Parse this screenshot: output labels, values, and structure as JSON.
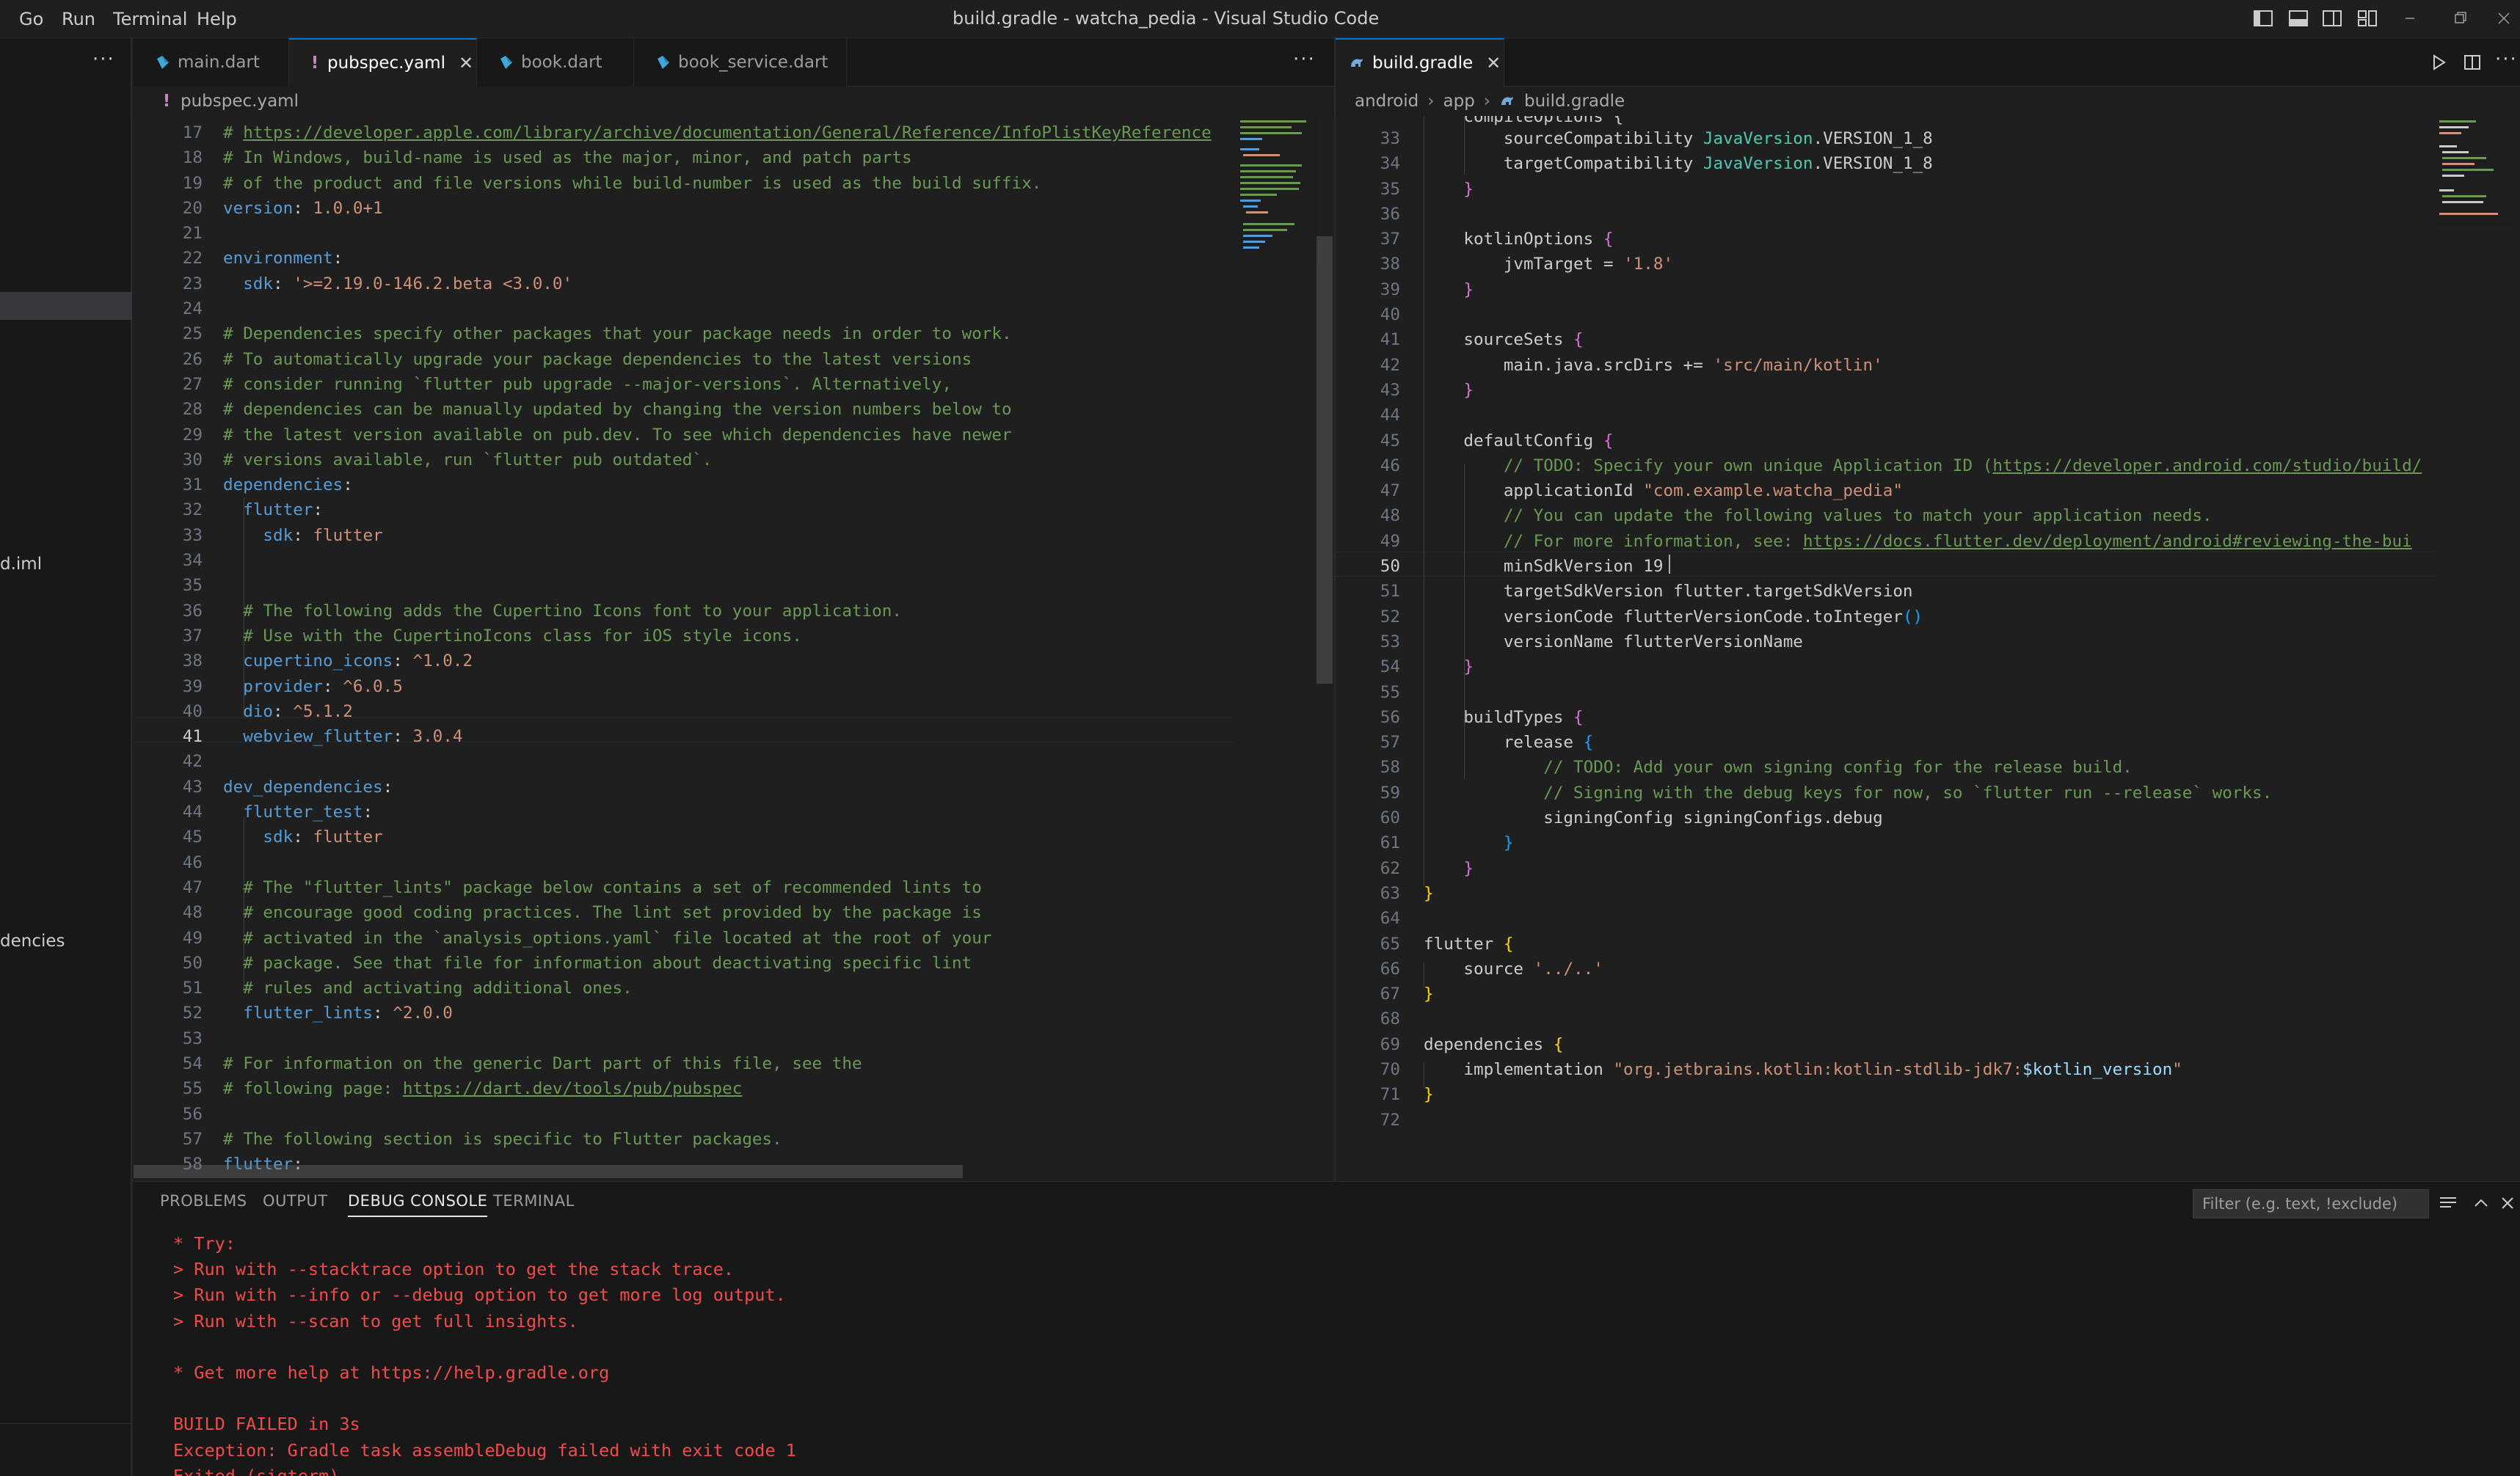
{
  "titlebar": {
    "menu": [
      "Go",
      "Run",
      "Terminal",
      "Help"
    ],
    "title": "build.gradle - watcha_pedia - Visual Studio Code",
    "layout_icons": [
      "toggle-primary-sidebar-icon",
      "toggle-panel-icon",
      "toggle-secondary-sidebar-icon",
      "customize-layout-icon"
    ],
    "window_controls": [
      "minimize-icon",
      "restore-icon",
      "close-icon"
    ]
  },
  "sidebar": {
    "more": "···",
    "fragments": [
      "d.iml",
      "dencies"
    ]
  },
  "left_group": {
    "tabs": [
      {
        "label": "main.dart",
        "type": "dart"
      },
      {
        "label": "pubspec.yaml",
        "type": "yaml",
        "active": true
      },
      {
        "label": "book.dart",
        "type": "dart"
      },
      {
        "label": "book_service.dart",
        "type": "dart"
      }
    ],
    "more": "···",
    "breadcrumb": [
      "pubspec.yaml"
    ],
    "current_line": "41"
  },
  "right_group": {
    "tabs": [
      {
        "label": "build.gradle",
        "type": "gradle",
        "active": true
      }
    ],
    "breadcrumb": [
      "android",
      "app",
      "build.gradle"
    ],
    "current_line": "50"
  },
  "left_code": [
    {
      "n": "17",
      "t": [
        [
          "# ",
          "c-cm"
        ],
        [
          "https://developer.apple.com/library/archive/documentation/General/Reference/InfoPlistKeyReference",
          "c-link"
        ]
      ]
    },
    {
      "n": "18",
      "t": [
        [
          "# In Windows, build-name is used as the major, minor, and patch parts",
          "c-cm"
        ]
      ]
    },
    {
      "n": "19",
      "t": [
        [
          "# of the product and file versions while build-number is used as the build suffix.",
          "c-cm"
        ]
      ]
    },
    {
      "n": "20",
      "t": [
        [
          "version",
          "c-key"
        ],
        [
          ": ",
          "c-plain"
        ],
        [
          "1.0.0+1",
          "c-val"
        ]
      ]
    },
    {
      "n": "21",
      "t": []
    },
    {
      "n": "22",
      "t": [
        [
          "environment",
          "c-key"
        ],
        [
          ":",
          "c-plain"
        ]
      ]
    },
    {
      "n": "23",
      "t": [
        [
          "  sdk",
          "c-key"
        ],
        [
          ": ",
          "c-plain"
        ],
        [
          "'>=2.19.0-146.2.beta <3.0.0'",
          "c-str"
        ]
      ]
    },
    {
      "n": "24",
      "t": []
    },
    {
      "n": "25",
      "t": [
        [
          "# Dependencies specify other packages that your package needs in order to work.",
          "c-cm"
        ]
      ]
    },
    {
      "n": "26",
      "t": [
        [
          "# To automatically upgrade your package dependencies to the latest versions",
          "c-cm"
        ]
      ]
    },
    {
      "n": "27",
      "t": [
        [
          "# consider running `flutter pub upgrade --major-versions`. Alternatively,",
          "c-cm"
        ]
      ]
    },
    {
      "n": "28",
      "t": [
        [
          "# dependencies can be manually updated by changing the version numbers below to",
          "c-cm"
        ]
      ]
    },
    {
      "n": "29",
      "t": [
        [
          "# the latest version available on pub.dev. To see which dependencies have newer",
          "c-cm"
        ]
      ]
    },
    {
      "n": "30",
      "t": [
        [
          "# versions available, run `flutter pub outdated`.",
          "c-cm"
        ]
      ]
    },
    {
      "n": "31",
      "t": [
        [
          "dependencies",
          "c-key"
        ],
        [
          ":",
          "c-plain"
        ]
      ]
    },
    {
      "n": "32",
      "t": [
        [
          "  flutter",
          "c-key"
        ],
        [
          ":",
          "c-plain"
        ]
      ]
    },
    {
      "n": "33",
      "t": [
        [
          "    sdk",
          "c-key"
        ],
        [
          ": ",
          "c-plain"
        ],
        [
          "flutter",
          "c-val"
        ]
      ]
    },
    {
      "n": "34",
      "t": []
    },
    {
      "n": "35",
      "t": []
    },
    {
      "n": "36",
      "t": [
        [
          "  # The following adds the Cupertino Icons font to your application.",
          "c-cm"
        ]
      ]
    },
    {
      "n": "37",
      "t": [
        [
          "  # Use with the CupertinoIcons class for iOS style icons.",
          "c-cm"
        ]
      ]
    },
    {
      "n": "38",
      "t": [
        [
          "  cupertino_icons",
          "c-key"
        ],
        [
          ": ",
          "c-plain"
        ],
        [
          "^1.0.2",
          "c-val"
        ]
      ]
    },
    {
      "n": "39",
      "t": [
        [
          "  provider",
          "c-key"
        ],
        [
          ": ",
          "c-plain"
        ],
        [
          "^6.0.5",
          "c-val"
        ]
      ]
    },
    {
      "n": "40",
      "t": [
        [
          "  dio",
          "c-key"
        ],
        [
          ": ",
          "c-plain"
        ],
        [
          "^5.1.2",
          "c-val"
        ]
      ]
    },
    {
      "n": "41",
      "t": [
        [
          "  webview_flutter",
          "c-key"
        ],
        [
          ": ",
          "c-plain"
        ],
        [
          "3.0.4",
          "c-val"
        ]
      ]
    },
    {
      "n": "42",
      "t": []
    },
    {
      "n": "43",
      "t": [
        [
          "dev_dependencies",
          "c-key"
        ],
        [
          ":",
          "c-plain"
        ]
      ]
    },
    {
      "n": "44",
      "t": [
        [
          "  flutter_test",
          "c-key"
        ],
        [
          ":",
          "c-plain"
        ]
      ]
    },
    {
      "n": "45",
      "t": [
        [
          "    sdk",
          "c-key"
        ],
        [
          ": ",
          "c-plain"
        ],
        [
          "flutter",
          "c-val"
        ]
      ]
    },
    {
      "n": "46",
      "t": []
    },
    {
      "n": "47",
      "t": [
        [
          "  # The \"flutter_lints\" package below contains a set of recommended lints to",
          "c-cm"
        ]
      ]
    },
    {
      "n": "48",
      "t": [
        [
          "  # encourage good coding practices. The lint set provided by the package is",
          "c-cm"
        ]
      ]
    },
    {
      "n": "49",
      "t": [
        [
          "  # activated in the `analysis_options.yaml` file located at the root of your",
          "c-cm"
        ]
      ]
    },
    {
      "n": "50",
      "t": [
        [
          "  # package. See that file for information about deactivating specific lint",
          "c-cm"
        ]
      ]
    },
    {
      "n": "51",
      "t": [
        [
          "  # rules and activating additional ones.",
          "c-cm"
        ]
      ]
    },
    {
      "n": "52",
      "t": [
        [
          "  flutter_lints",
          "c-key"
        ],
        [
          ": ",
          "c-plain"
        ],
        [
          "^2.0.0",
          "c-val"
        ]
      ]
    },
    {
      "n": "53",
      "t": []
    },
    {
      "n": "54",
      "t": [
        [
          "# For information on the generic Dart part of this file, see the",
          "c-cm"
        ]
      ]
    },
    {
      "n": "55",
      "t": [
        [
          "# following page: ",
          "c-cm"
        ],
        [
          "https://dart.dev/tools/pub/pubspec",
          "c-link"
        ]
      ]
    },
    {
      "n": "56",
      "t": []
    },
    {
      "n": "57",
      "t": [
        [
          "# The following section is specific to Flutter packages.",
          "c-cm"
        ]
      ]
    },
    {
      "n": "58",
      "t": [
        [
          "flutter",
          "c-key"
        ],
        [
          ":",
          "c-plain"
        ]
      ]
    }
  ],
  "right_code": [
    {
      "n": "33",
      "t": [
        [
          "        sourceCompatibility ",
          "c-plain"
        ],
        [
          "JavaVersion",
          "c-cls"
        ],
        [
          ".VERSION_1_8",
          "c-plain"
        ]
      ]
    },
    {
      "n": "34",
      "t": [
        [
          "        targetCompatibility ",
          "c-plain"
        ],
        [
          "JavaVersion",
          "c-cls"
        ],
        [
          ".VERSION_1_8",
          "c-plain"
        ]
      ]
    },
    {
      "n": "35",
      "t": [
        [
          "    ",
          "c-plain"
        ],
        [
          "}",
          "c-b2"
        ]
      ]
    },
    {
      "n": "36",
      "t": []
    },
    {
      "n": "37",
      "t": [
        [
          "    kotlinOptions ",
          "c-plain"
        ],
        [
          "{",
          "c-b2"
        ]
      ]
    },
    {
      "n": "38",
      "t": [
        [
          "        jvmTarget = ",
          "c-plain"
        ],
        [
          "'1.8'",
          "c-str"
        ]
      ]
    },
    {
      "n": "39",
      "t": [
        [
          "    ",
          "c-plain"
        ],
        [
          "}",
          "c-b2"
        ]
      ]
    },
    {
      "n": "40",
      "t": []
    },
    {
      "n": "41",
      "t": [
        [
          "    sourceSets ",
          "c-plain"
        ],
        [
          "{",
          "c-b2"
        ]
      ]
    },
    {
      "n": "42",
      "t": [
        [
          "        main.java.srcDirs += ",
          "c-plain"
        ],
        [
          "'src/main/kotlin'",
          "c-str"
        ]
      ]
    },
    {
      "n": "43",
      "t": [
        [
          "    ",
          "c-plain"
        ],
        [
          "}",
          "c-b2"
        ]
      ]
    },
    {
      "n": "44",
      "t": []
    },
    {
      "n": "45",
      "t": [
        [
          "    defaultConfig ",
          "c-plain"
        ],
        [
          "{",
          "c-b2"
        ]
      ]
    },
    {
      "n": "46",
      "t": [
        [
          "        // TODO: Specify your own unique Application ID (",
          "c-cm"
        ],
        [
          "https://developer.android.com/studio/build/",
          "c-link"
        ]
      ]
    },
    {
      "n": "47",
      "t": [
        [
          "        applicationId ",
          "c-plain"
        ],
        [
          "\"com.example.watcha_pedia\"",
          "c-str"
        ]
      ]
    },
    {
      "n": "48",
      "t": [
        [
          "        // You can update the following values to match your application needs.",
          "c-cm"
        ]
      ]
    },
    {
      "n": "49",
      "t": [
        [
          "        // For more information, see: ",
          "c-cm"
        ],
        [
          "https://docs.flutter.dev/deployment/android#reviewing-the-bui",
          "c-link"
        ]
      ]
    },
    {
      "n": "50",
      "t": [
        [
          "        minSdkVersion ",
          "c-plain"
        ],
        [
          "19",
          "c-plain"
        ]
      ]
    },
    {
      "n": "51",
      "t": [
        [
          "        targetSdkVersion flutter.targetSdkVersion",
          "c-plain"
        ]
      ]
    },
    {
      "n": "52",
      "t": [
        [
          "        versionCode flutterVersionCode.toInteger",
          "c-plain"
        ],
        [
          "()",
          "c-b3"
        ]
      ]
    },
    {
      "n": "53",
      "t": [
        [
          "        versionName flutterVersionName",
          "c-plain"
        ]
      ]
    },
    {
      "n": "54",
      "t": [
        [
          "    ",
          "c-plain"
        ],
        [
          "}",
          "c-b2"
        ]
      ]
    },
    {
      "n": "55",
      "t": []
    },
    {
      "n": "56",
      "t": [
        [
          "    buildTypes ",
          "c-plain"
        ],
        [
          "{",
          "c-b2"
        ]
      ]
    },
    {
      "n": "57",
      "t": [
        [
          "        release ",
          "c-plain"
        ],
        [
          "{",
          "c-b3"
        ]
      ]
    },
    {
      "n": "58",
      "t": [
        [
          "            // TODO: Add your own signing config for the release build.",
          "c-cm"
        ]
      ]
    },
    {
      "n": "59",
      "t": [
        [
          "            // Signing with the debug keys for now, so `flutter run --release` works.",
          "c-cm"
        ]
      ]
    },
    {
      "n": "60",
      "t": [
        [
          "            signingConfig signingConfigs.debug",
          "c-plain"
        ]
      ]
    },
    {
      "n": "61",
      "t": [
        [
          "        ",
          "c-plain"
        ],
        [
          "}",
          "c-b3"
        ]
      ]
    },
    {
      "n": "62",
      "t": [
        [
          "    ",
          "c-plain"
        ],
        [
          "}",
          "c-b2"
        ]
      ]
    },
    {
      "n": "63",
      "t": [
        [
          "}",
          "c-b1"
        ]
      ]
    },
    {
      "n": "64",
      "t": []
    },
    {
      "n": "65",
      "t": [
        [
          "flutter ",
          "c-plain"
        ],
        [
          "{",
          "c-b1"
        ]
      ]
    },
    {
      "n": "66",
      "t": [
        [
          "    source ",
          "c-plain"
        ],
        [
          "'../..'",
          "c-str"
        ]
      ]
    },
    {
      "n": "67",
      "t": [
        [
          "}",
          "c-b1"
        ]
      ]
    },
    {
      "n": "68",
      "t": []
    },
    {
      "n": "69",
      "t": [
        [
          "dependencies ",
          "c-plain"
        ],
        [
          "{",
          "c-b1"
        ]
      ]
    },
    {
      "n": "70",
      "t": [
        [
          "    implementation ",
          "c-plain"
        ],
        [
          "\"org.jetbrains.kotlin:kotlin-stdlib-jdk7:",
          "c-str"
        ],
        [
          "$kotlin_version",
          "c-var"
        ],
        [
          "\"",
          "c-str"
        ]
      ]
    },
    {
      "n": "71",
      "t": [
        [
          "}",
          "c-b1"
        ]
      ]
    },
    {
      "n": "72",
      "t": []
    }
  ],
  "right_code_partial_top": "    compileOptions {",
  "panel": {
    "tabs": [
      "PROBLEMS",
      "OUTPUT",
      "DEBUG CONSOLE",
      "TERMINAL"
    ],
    "active_tab": "DEBUG CONSOLE",
    "filter_placeholder": "Filter (e.g. text, !exclude)",
    "lines": [
      "* Try:",
      "> Run with --stacktrace option to get the stack trace.",
      "> Run with --info or --debug option to get more log output.",
      "> Run with --scan to get full insights.",
      "",
      "* Get more help at https://help.gradle.org",
      "",
      "BUILD FAILED in 3s",
      "Exception: Gradle task assembleDebug failed with exit code 1",
      "Exited (sigterm)"
    ]
  },
  "colors": {
    "accent": "#0078d4",
    "error": "#f14c4c",
    "comment": "#6a9955",
    "key": "#569cd6",
    "string": "#ce9178"
  }
}
